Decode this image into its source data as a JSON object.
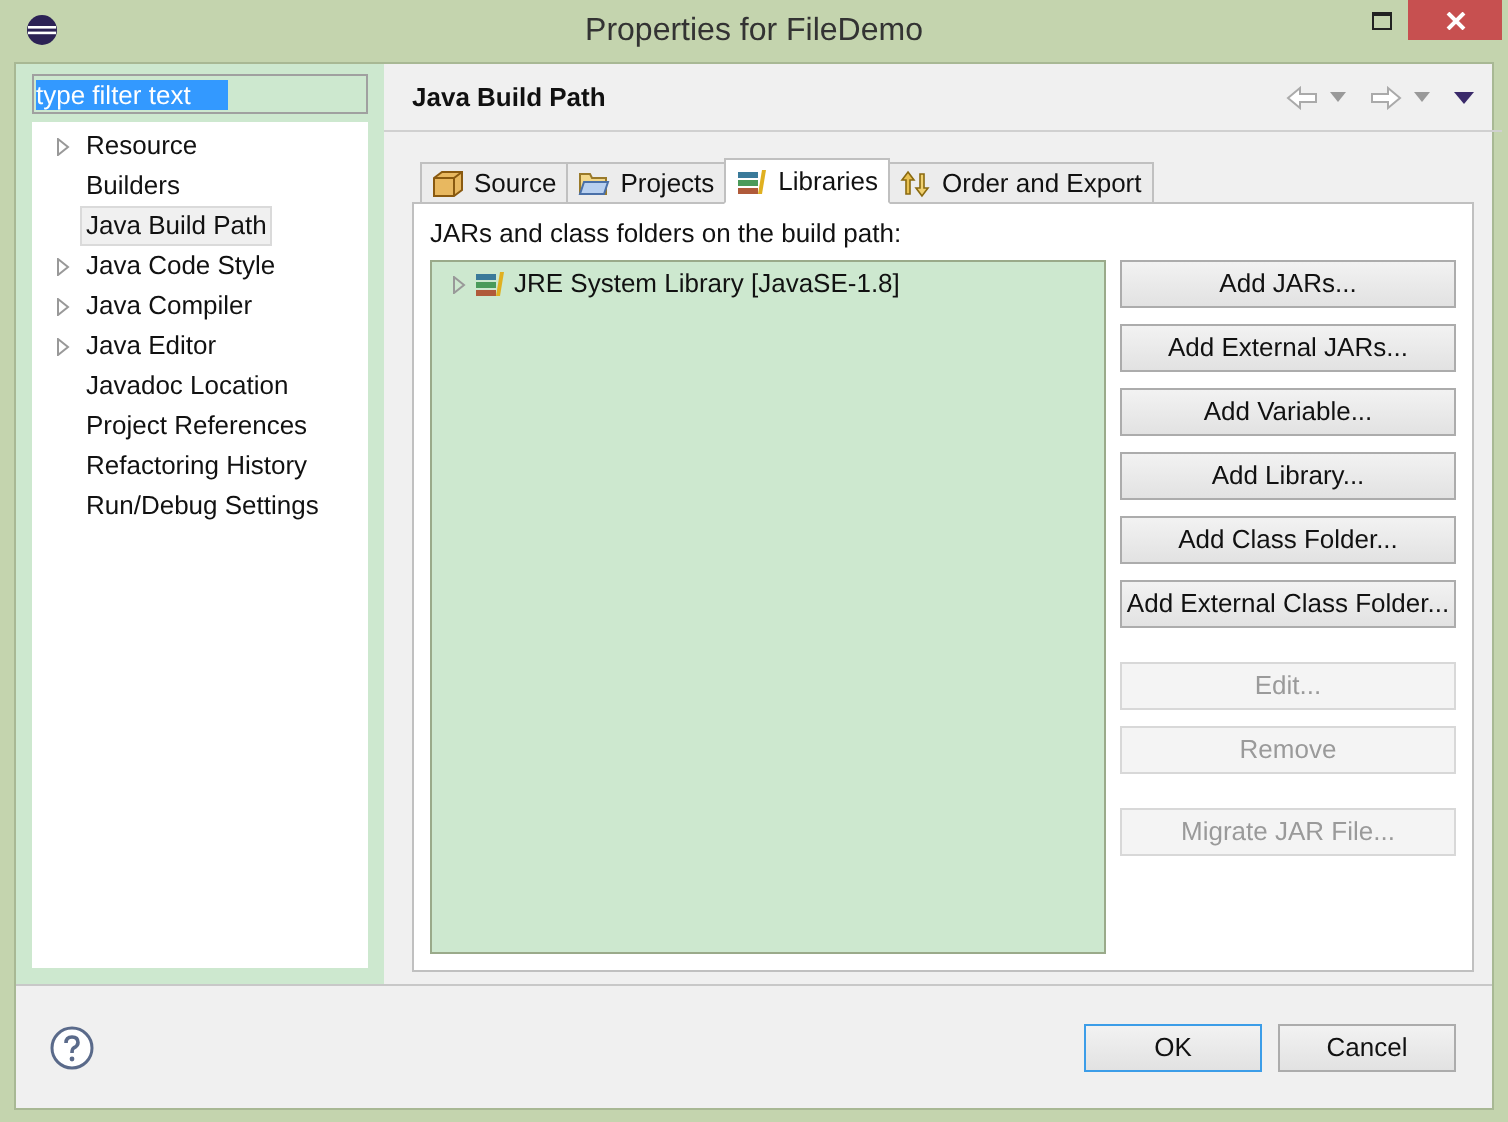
{
  "window": {
    "title": "Properties for FileDemo"
  },
  "filter": {
    "value": "type filter text"
  },
  "tree": [
    {
      "label": "Resource",
      "expandable": true,
      "selected": false
    },
    {
      "label": "Builders",
      "expandable": false,
      "selected": false
    },
    {
      "label": "Java Build Path",
      "expandable": false,
      "selected": true
    },
    {
      "label": "Java Code Style",
      "expandable": true,
      "selected": false
    },
    {
      "label": "Java Compiler",
      "expandable": true,
      "selected": false
    },
    {
      "label": "Java Editor",
      "expandable": true,
      "selected": false
    },
    {
      "label": "Javadoc Location",
      "expandable": false,
      "selected": false
    },
    {
      "label": "Project References",
      "expandable": false,
      "selected": false
    },
    {
      "label": "Refactoring History",
      "expandable": false,
      "selected": false
    },
    {
      "label": "Run/Debug Settings",
      "expandable": false,
      "selected": false
    }
  ],
  "page": {
    "title": "Java Build Path"
  },
  "tabs": [
    {
      "label": "Source",
      "kind": "source",
      "selected": false
    },
    {
      "label": "Projects",
      "kind": "projects",
      "selected": false
    },
    {
      "label": "Libraries",
      "kind": "libraries",
      "selected": true
    },
    {
      "label": "Order and Export",
      "kind": "order",
      "selected": false
    }
  ],
  "list_label": "JARs and class folders on the build path:",
  "libraries": [
    {
      "label": "JRE System Library [JavaSE-1.8]",
      "expanded": false
    }
  ],
  "button_groups": [
    [
      {
        "label": "Add JARs...",
        "disabled": false
      },
      {
        "label": "Add External JARs...",
        "disabled": false
      },
      {
        "label": "Add Variable...",
        "disabled": false
      },
      {
        "label": "Add Library...",
        "disabled": false
      },
      {
        "label": "Add Class Folder...",
        "disabled": false
      },
      {
        "label": "Add External Class Folder...",
        "disabled": false
      }
    ],
    [
      {
        "label": "Edit...",
        "disabled": true
      },
      {
        "label": "Remove",
        "disabled": true
      }
    ],
    [
      {
        "label": "Migrate JAR File...",
        "disabled": true
      }
    ]
  ],
  "dialog_buttons": [
    {
      "label": "OK",
      "default": true
    },
    {
      "label": "Cancel",
      "default": false
    }
  ]
}
